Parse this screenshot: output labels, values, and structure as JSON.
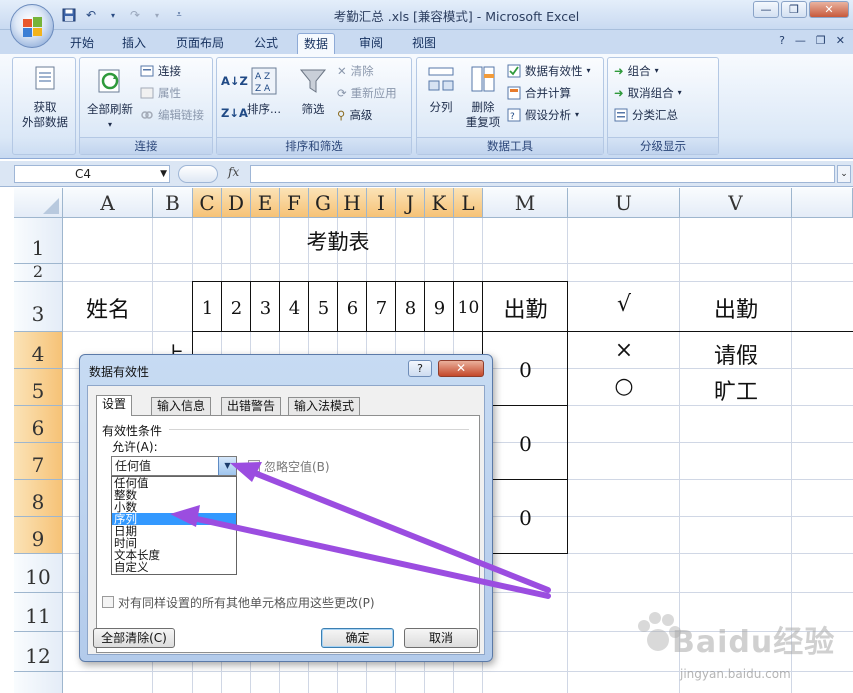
{
  "window": {
    "title": "考勤汇总 .xls  [兼容模式] - Microsoft Excel",
    "controls": [
      "—",
      "❐",
      "✕"
    ]
  },
  "menu": {
    "tabs": [
      "开始",
      "插入",
      "页面布局",
      "公式",
      "数据",
      "审阅",
      "视图"
    ],
    "active": "数据",
    "right_icons": [
      "?",
      "—",
      "❐",
      "✕"
    ]
  },
  "ribbon": {
    "get_external": {
      "line1": "获取",
      "line2": "外部数据"
    },
    "connections": {
      "refresh_all": "全部刷新",
      "connect": "连接",
      "properties": "属性",
      "edit_links": "编辑链接",
      "label": "连接"
    },
    "sort_filter": {
      "sort": "排序...",
      "filter": "筛选",
      "clear": "清除",
      "reapply": "重新应用",
      "advanced": "高级",
      "label": "排序和筛选"
    },
    "data_tools": {
      "split": "分列",
      "remove_dup_l1": "删除",
      "remove_dup_l2": "重复项",
      "validation": "数据有效性",
      "consolidate": "合并计算",
      "whatif": "假设分析",
      "label": "数据工具"
    },
    "outline": {
      "group": "组合",
      "ungroup": "取消组合",
      "subtotal": "分类汇总",
      "label": "分级显示"
    }
  },
  "formula_bar": {
    "name_box": "C4",
    "fx": "fx",
    "value": ""
  },
  "sheet": {
    "columns": [
      "A",
      "B",
      "C",
      "D",
      "E",
      "F",
      "G",
      "H",
      "I",
      "J",
      "K",
      "L",
      "M",
      "U",
      "V"
    ],
    "rows": [
      "1",
      "2",
      "3",
      "4",
      "5",
      "6",
      "7",
      "8",
      "9",
      "10",
      "11",
      "12"
    ],
    "title": "考勤表",
    "name_header": "姓名",
    "day_numbers": [
      "1",
      "2",
      "3",
      "4",
      "5",
      "6",
      "7",
      "8",
      "9",
      "10"
    ],
    "attendance_header": "出勤",
    "b4_partial": "上",
    "attendance_values": [
      "0",
      "0",
      "0"
    ],
    "legend": [
      {
        "symbol": "√",
        "meaning": "出勤"
      },
      {
        "symbol": "×",
        "meaning": "请假"
      },
      {
        "symbol": "○",
        "meaning": "旷工"
      }
    ]
  },
  "dialog": {
    "title": "数据有效性",
    "help": "?",
    "close": "✕",
    "tabs": [
      "设置",
      "输入信息",
      "出错警告",
      "输入法模式"
    ],
    "section": "有效性条件",
    "allow_label": "允许(A):",
    "allow_value": "任何值",
    "ignore_blank": "忽略空值(B)",
    "options": [
      "任何值",
      "整数",
      "小数",
      "序列",
      "日期",
      "时间",
      "文本长度",
      "自定义"
    ],
    "highlighted": "序列",
    "apply_all": "对有同样设置的所有其他单元格应用这些更改(P)",
    "clear_all": "全部清除(C)",
    "ok": "确定",
    "cancel": "取消"
  },
  "watermark": {
    "text": "Baidu经验",
    "sub": "jingyan.baidu.com"
  },
  "colors": {
    "selected_header": "#f6c276",
    "highlight": "#3399ff",
    "arrow": "#9b4de0"
  }
}
